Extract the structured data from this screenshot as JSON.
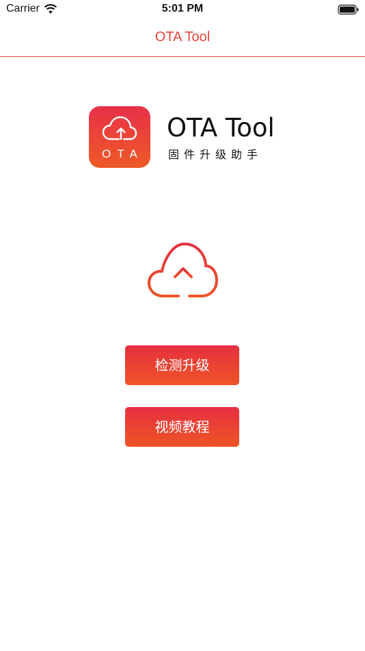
{
  "status_bar": {
    "carrier": "Carrier",
    "time": "5:01 PM",
    "wifi_icon": "wifi-icon",
    "battery_icon": "battery-icon"
  },
  "nav": {
    "title": "OTA Tool"
  },
  "logo": {
    "app_icon_label": "OTA",
    "brand_name": "OTA Tool",
    "subtitle": "固件升级助手",
    "icon": "cloud-upload-icon"
  },
  "main": {
    "illustration_icon": "cloud-upload-icon"
  },
  "actions": {
    "check_update_label": "检测升级",
    "video_tutorial_label": "视频教程"
  },
  "colors": {
    "accent": "#e8433a",
    "gradient_top": "#e63040",
    "gradient_bottom": "#ee5426"
  }
}
